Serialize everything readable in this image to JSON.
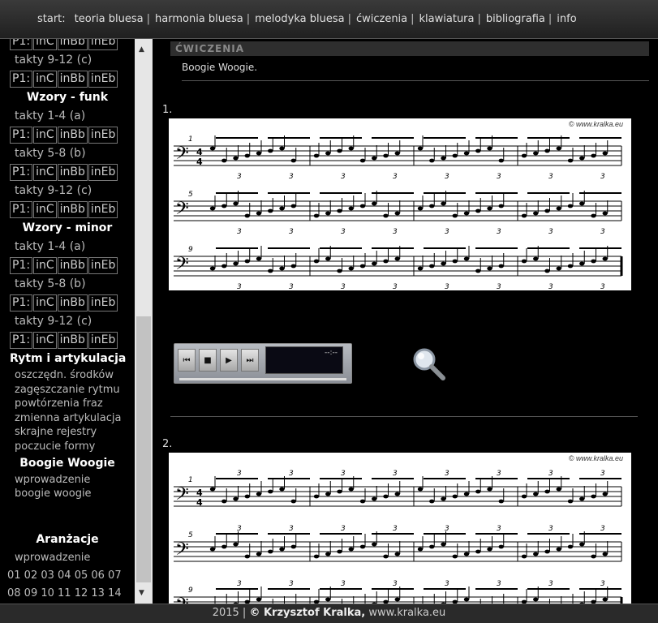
{
  "nav": {
    "start_label": "start:",
    "items": [
      {
        "label": "teoria bluesa",
        "sep": "|"
      },
      {
        "label": "harmonia bluesa",
        "sep": "|"
      },
      {
        "label": "melodyka bluesa",
        "sep": "|"
      },
      {
        "label": "ćwiczenia",
        "sep": "|"
      },
      {
        "label": "klawiatura",
        "sep": "|"
      },
      {
        "label": "bibliografia",
        "sep": "|"
      },
      {
        "label": "info",
        "sep": ""
      }
    ]
  },
  "sidebar": {
    "player_buttons": [
      "P1:",
      "inC",
      "inBb",
      "inEb"
    ],
    "bars": [
      "takty 9-12 (c)",
      "takty 1-4 (a)",
      "takty 5-8 (b)",
      "takty 9-12 (c)"
    ],
    "funk_heading": "Wzory - funk",
    "minor_heading": "Wzory - minor",
    "rytm_heading": "Rytm i artykulacja",
    "rytm_links": [
      "oszczędn. środków",
      "zagęszczanie rytmu",
      "powtórzenia fraz",
      "zmienna artykulacja",
      "skrajne rejestry",
      "poczucie formy"
    ],
    "boogie_heading": "Boogie Woogie",
    "boogie_links": [
      "wprowadzenie",
      "boogie woogie"
    ],
    "aranzacje_heading": "Aranżacje",
    "aranzacje_intro": "wprowadzenie",
    "numbers_row1": "01 02 03 04 05 06 07",
    "numbers_row2": "08 09 10 11 12 13 14",
    "scroll_up": "▲",
    "scroll_down": "▼"
  },
  "main": {
    "section_title": "ĆWICZENIA",
    "subtitle": "Boogie Woogie.",
    "ex1_label": "1.",
    "ex2_label": "2.",
    "copyright_mark": "© www.kralka.eu",
    "staff1_bar_numbers": [
      "1",
      "5",
      "9"
    ],
    "staff2_bar_numbers": [
      "1",
      "5",
      "9"
    ],
    "triplet_mark": "3",
    "player": {
      "prev_icon": "⏮",
      "stop_icon": "■",
      "play_icon": "▶",
      "next_icon": "⏭",
      "time": "--:--"
    }
  },
  "footer": {
    "year": "2015 |",
    "copyright": "© Krzysztof Kralka,",
    "site": "www.kralka.eu"
  },
  "colors": {
    "background": "#000000",
    "topbar": "#2c2c2c",
    "sheet": "#ffffff"
  }
}
